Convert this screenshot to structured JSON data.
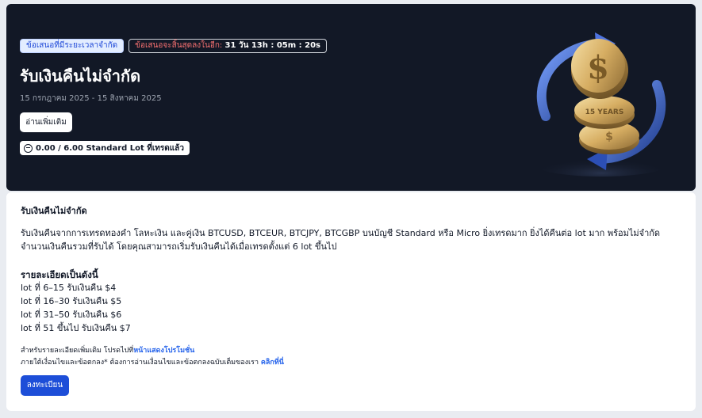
{
  "hero": {
    "badge_limited": "ข้อเสนอที่มีระยะเวลาจำกัด",
    "countdown_label": "ข้อเสนอจะสิ้นสุดลงในอีก:",
    "countdown_time": "31 วัน 13h : 05m : 20s",
    "title": "รับเงินคืนไม่จำกัด",
    "dates": "15 กรกฎาคม 2025 - 15 สิงหาคม 2025",
    "read_more_label": "อ่านเพิ่มเติม",
    "lot_progress": "0.00 / 6.00 Standard Lot ที่เทรดแล้ว",
    "progress_icon": "minus-circle-icon",
    "illustration_icon": "dollar-coins-cashback-icon",
    "coin_text": "15 YEARS"
  },
  "details": {
    "section_title": "รับเงินคืนไม่จำกัด",
    "description": "รับเงินคืนจากการเทรดทองคำ โลหะเงิน และคู่เงิน BTCUSD, BTCEUR, BTCJPY, BTCGBP บนบัญชี Standard หรือ Micro ยิ่งเทรดมาก ยิ่งได้คืนต่อ lot มาก พร้อมไม่จำกัดจำนวนเงินคืนรวมที่รับได้ โดยคุณสามารถเริ่มรับเงินคืนได้เมื่อเทรดตั้งแต่ 6 lot ขึ้นไป",
    "tiers_heading": "รายละเอียดเป็นดังนี้",
    "tiers": [
      "lot ที่ 6–15 รับเงินคืน $4",
      "lot ที่ 16–30 รับเงินคืน $5",
      "lot ที่ 31–50 รับเงินคืน $6",
      "lot ที่ 51 ขึ้นไป รับเงินคืน $7"
    ],
    "note1_prefix": "สำหรับรายละเอียดเพิ่มเติม โปรดไปที่",
    "note1_link": "หน้าแสดงโปรโมชั่น",
    "note2_prefix": "ภายใต้เงื่อนไขและข้อตกลง* ต้องการอ่านเงื่อนไขและข้อตกลงฉบับเต็มของเรา ",
    "note2_link": "คลิกที่นี่",
    "register_label": "ลงทะเบียน"
  },
  "colors": {
    "hero_bg": "#121826",
    "accent_blue": "#1d4ed8",
    "link_blue": "#2563eb",
    "countdown_red": "#f87171",
    "page_bg": "#e9ecf1"
  }
}
